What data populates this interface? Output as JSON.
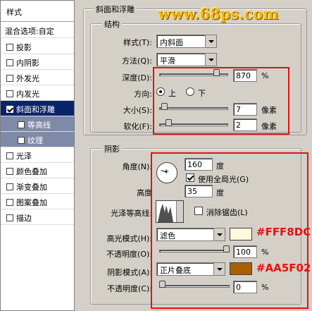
{
  "watermark": "www.68ps.com",
  "colors": {
    "accent_red": "#E8100C",
    "selected_bg": "#0A246A",
    "sub_bg": "#7F8AA8",
    "highlight_swatch": "#FFF8DC",
    "shadow_swatch": "#AA5F02"
  },
  "sidebar": {
    "header": "样式",
    "blend_options": "混合选项:自定",
    "items": [
      {
        "label": "投影",
        "checked": false
      },
      {
        "label": "内阴影",
        "checked": false
      },
      {
        "label": "外发光",
        "checked": false
      },
      {
        "label": "内发光",
        "checked": false
      },
      {
        "label": "斜面和浮雕",
        "checked": true,
        "selected": true
      },
      {
        "label": "等高线",
        "checked": false,
        "sub": true
      },
      {
        "label": "纹理",
        "checked": false,
        "sub": true
      },
      {
        "label": "光泽",
        "checked": false
      },
      {
        "label": "颜色叠加",
        "checked": false
      },
      {
        "label": "渐变叠加",
        "checked": false
      },
      {
        "label": "图案叠加",
        "checked": false
      },
      {
        "label": "描边",
        "checked": false
      }
    ]
  },
  "bevel": {
    "section_title": "斜面和浮雕",
    "structure_title": "结构",
    "style_label": "样式(T):",
    "style_value": "内斜面",
    "technique_label": "方法(Q):",
    "technique_value": "平滑",
    "depth_label": "深度(D):",
    "depth_value": "870",
    "depth_unit": "%",
    "depth_fraction": 0.87,
    "direction_label": "方向:",
    "direction_up": "上",
    "direction_down": "下",
    "direction_selected": "上",
    "size_label": "大小(S):",
    "size_value": "7",
    "size_unit": "像素",
    "size_fraction": 0.03,
    "soften_label": "软化(F):",
    "soften_value": "2",
    "soften_unit": "像素",
    "soften_fraction": 0.1
  },
  "shading": {
    "title": "阴影",
    "angle_label": "角度(N):",
    "angle_value": "160",
    "angle_unit": "度",
    "use_global_light": "使用全局光(G)",
    "use_global_light_checked": true,
    "altitude_label": "高度",
    "altitude_value": "35",
    "altitude_unit": "度",
    "gloss_contour_label": "光泽等高线:",
    "anti_aliased": "消除锯齿(L)",
    "anti_aliased_checked": false,
    "highlight_mode_label": "高光模式(H):",
    "highlight_mode_value": "滤色",
    "highlight_color_hex": "#FFF8DC",
    "highlight_opacity_label": "不透明度(O):",
    "highlight_opacity_value": "100",
    "highlight_opacity_unit": "%",
    "highlight_opacity_fraction": 1.0,
    "shadow_mode_label": "阴影模式(A):",
    "shadow_mode_value": "正片叠底",
    "shadow_color_hex": "#AA5F02",
    "shadow_opacity_label": "不透明度(C):",
    "shadow_opacity_value": "0",
    "shadow_opacity_unit": "%",
    "shadow_opacity_fraction": 0.0
  }
}
